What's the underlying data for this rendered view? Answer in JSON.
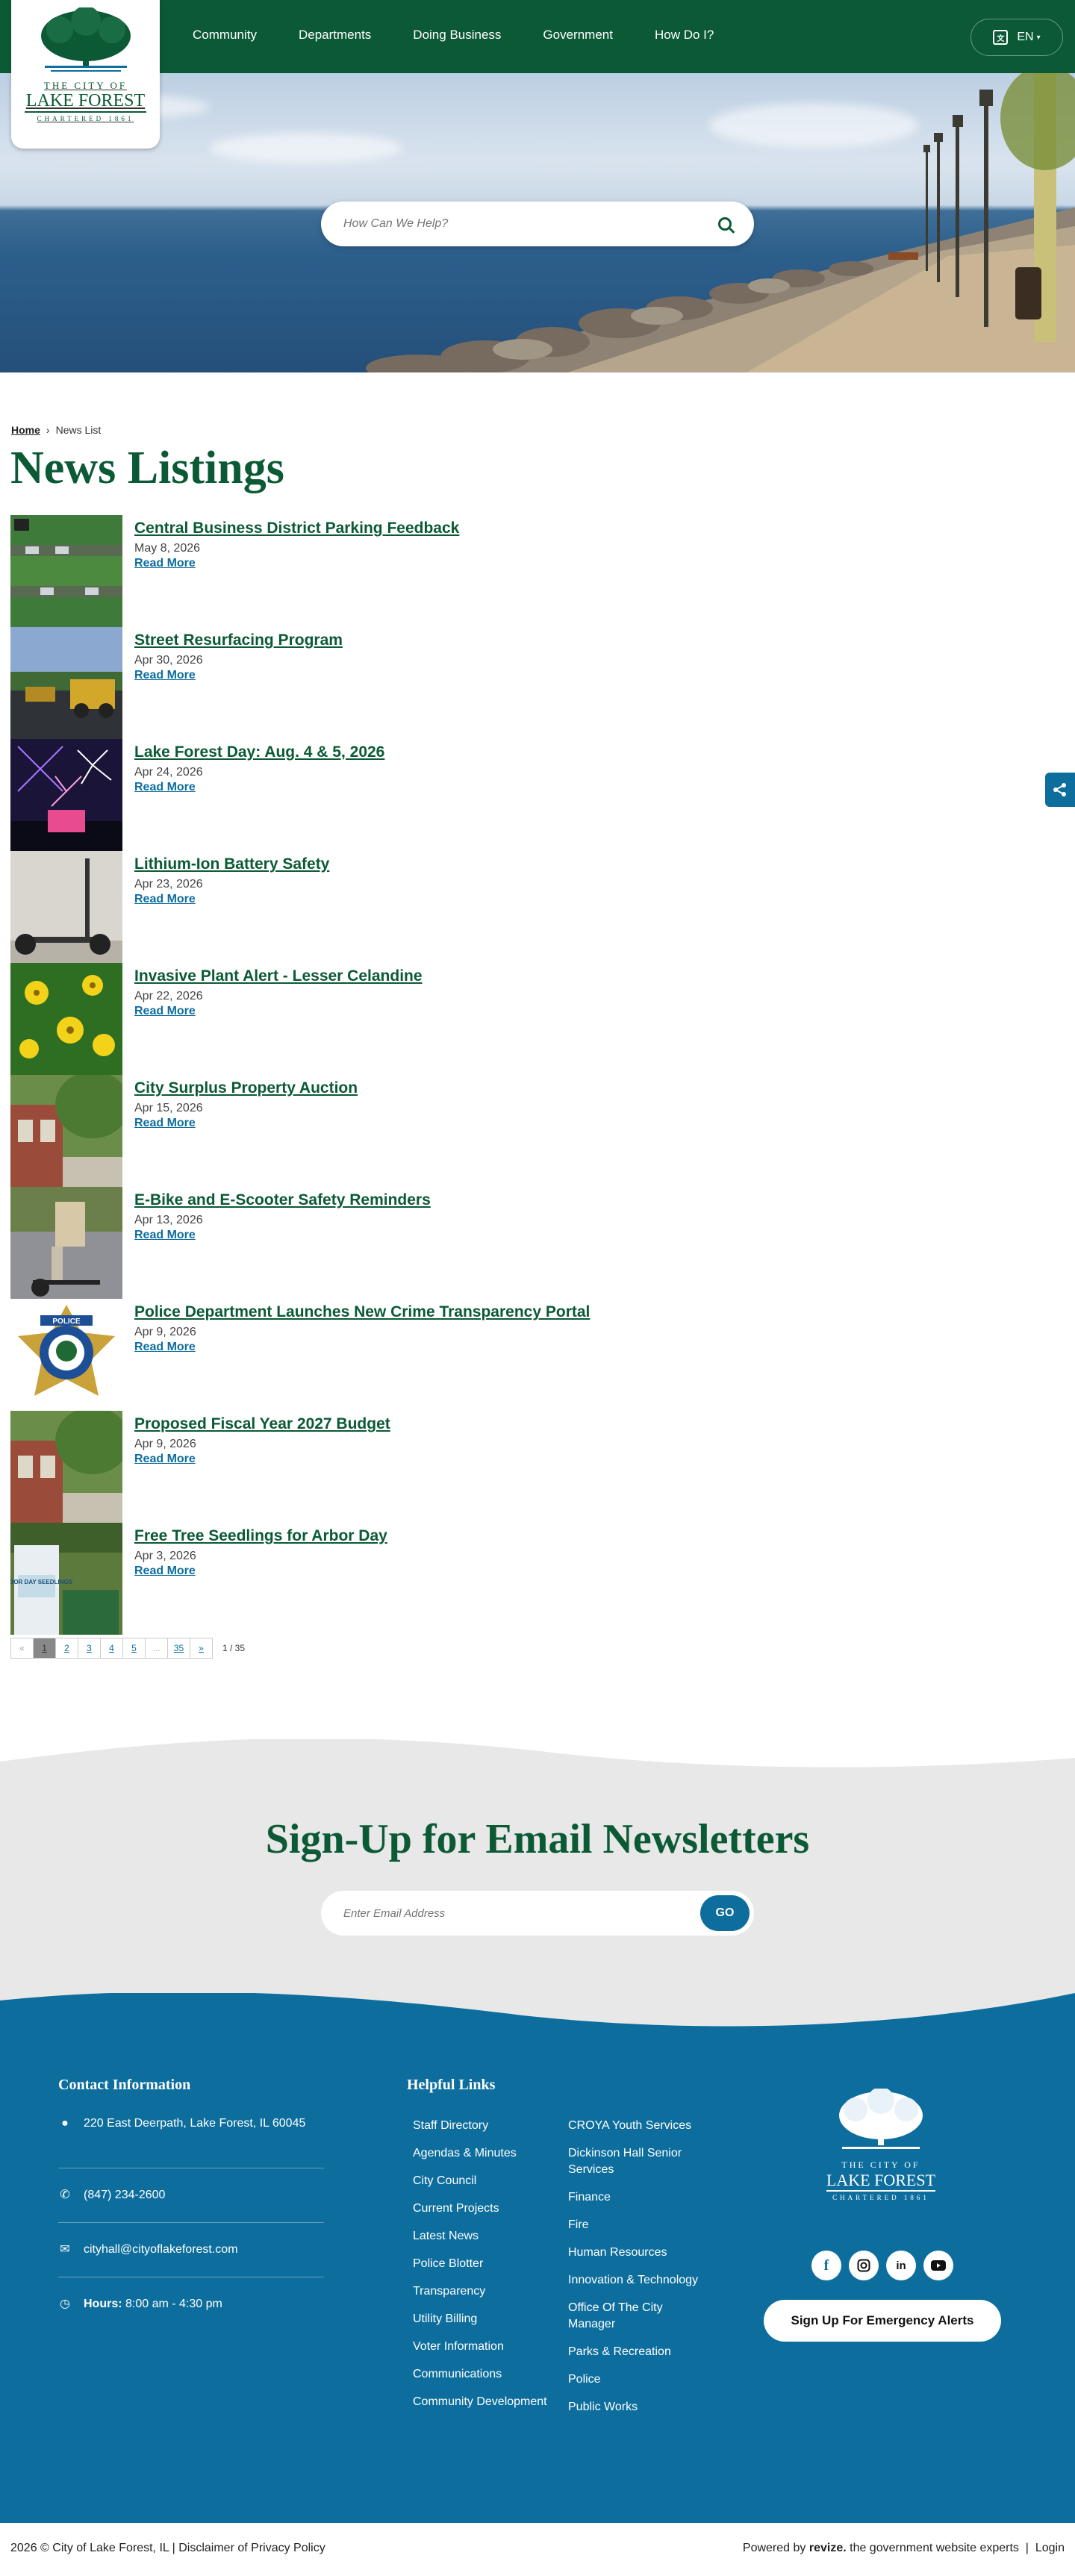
{
  "header": {
    "logo": {
      "line1": "THE CITY OF",
      "line2": "LAKE FOREST",
      "line3": "CHARTERED 1861"
    },
    "nav": [
      "Community",
      "Departments",
      "Doing Business",
      "Government",
      "How Do I?"
    ],
    "lang": "EN",
    "search_placeholder": "How Can We Help?"
  },
  "breadcrumb": {
    "home": "Home",
    "current": "News List"
  },
  "page_title": "News Listings",
  "read_more": "Read More",
  "news": [
    {
      "title": "Central Business District Parking Feedback",
      "date": "May 8, 2026",
      "thumb": "parking"
    },
    {
      "title": "Street Resurfacing Program",
      "date": "Apr 30, 2026",
      "thumb": "road"
    },
    {
      "title": "Lake Forest Day: Aug. 4 & 5, 2026",
      "date": "Apr 24, 2026",
      "thumb": "fireworks"
    },
    {
      "title": "Lithium-Ion Battery Safety",
      "date": "Apr 23, 2026",
      "thumb": "scooter"
    },
    {
      "title": "Invasive Plant Alert - Lesser Celandine",
      "date": "Apr 22, 2026",
      "thumb": "flowers"
    },
    {
      "title": "City Surplus Property Auction ",
      "date": "Apr 15, 2026",
      "thumb": "building"
    },
    {
      "title": "E-Bike and E-Scooter Safety Reminders",
      "date": "Apr 13, 2026",
      "thumb": "ebike"
    },
    {
      "title": "Police Department Launches New Crime Transparency Portal",
      "date": "Apr 9, 2026",
      "thumb": "badge"
    },
    {
      "title": "Proposed Fiscal Year 2027 Budget",
      "date": "Apr 9, 2026",
      "thumb": "building"
    },
    {
      "title": "Free Tree Seedlings for Arbor Day",
      "date": "Apr 3, 2026",
      "thumb": "arbor"
    }
  ],
  "badge_text": "POLICE",
  "arbor_text": "ARBOR DAY SEEDLINGS",
  "pagination": {
    "prev": "«",
    "pages": [
      "1",
      "2",
      "3",
      "4",
      "5",
      "...",
      "35"
    ],
    "next": "»",
    "count": "1 / 35"
  },
  "newsletter": {
    "heading": "Sign-Up for Email Newsletters",
    "placeholder": "Enter Email Address",
    "go": "GO"
  },
  "footer": {
    "contact_heading": "Contact Information",
    "address": "220 East Deerpath, Lake Forest, IL 60045",
    "phone": "(847) 234-2600",
    "email": "cityhall@cityoflakeforest.com",
    "hours_label": "Hours:",
    "hours": "8:00 am - 4:30 pm",
    "links_heading": "Helpful Links",
    "links_col1": [
      "Staff Directory",
      "Agendas & Minutes",
      "City Council",
      "Current Projects",
      "Latest News",
      "Police Blotter",
      "Transparency",
      "Utility Billing",
      "Voter Information",
      "Communications",
      "Community Development"
    ],
    "links_col2": [
      "CROYA  Youth Services",
      "Dickinson Hall Senior Services",
      "Finance",
      "Fire",
      "Human Resources",
      "Innovation & Technology",
      "Office Of The City Manager",
      "Parks & Recreation",
      "Police",
      "Public Works"
    ],
    "social": [
      "f",
      "ig",
      "in",
      "yt"
    ],
    "alert_button": "Sign Up For Emergency Alerts",
    "copyright": "2026 © City of Lake Forest, IL | Disclaimer of Privacy Policy",
    "powered": "Powered by",
    "brand": "revize.",
    "tagline": " the government website experts",
    "login": "Login"
  },
  "colors": {
    "green": "#0b5a35",
    "blue": "#0d6e9e",
    "grey_band": "#e8e8e8"
  }
}
